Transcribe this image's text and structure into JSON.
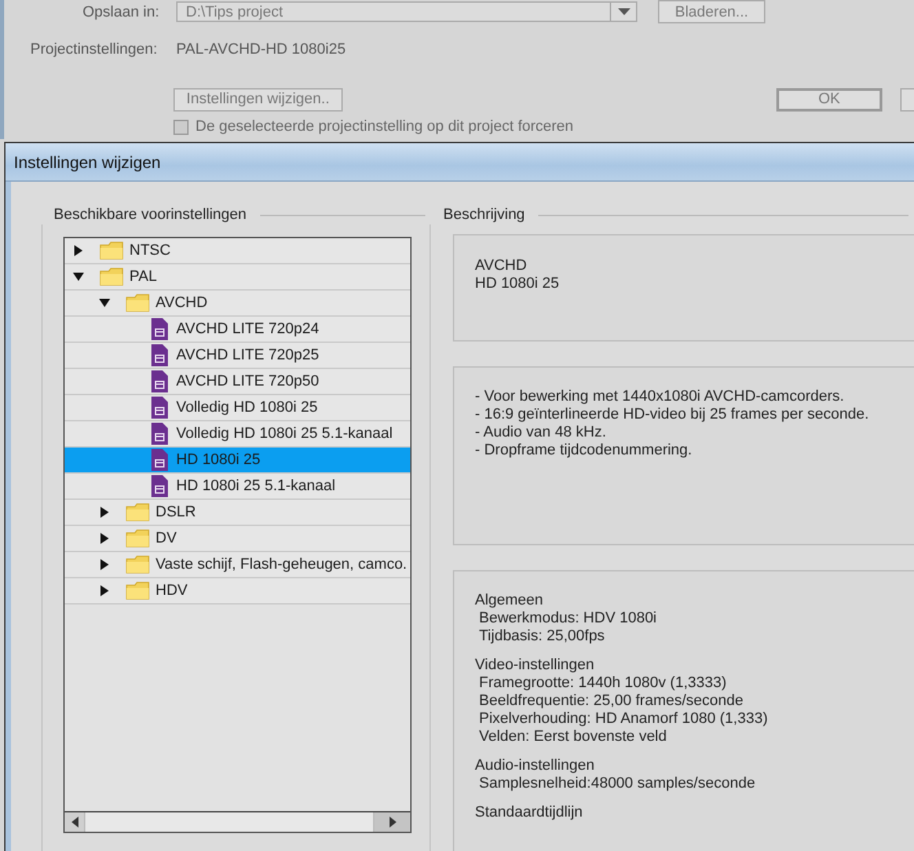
{
  "background_dialog": {
    "save_label": "Opslaan in:",
    "save_path": "D:\\Tips project",
    "browse_button": "Bladeren...",
    "project_settings_label": "Projectinstellingen:",
    "project_settings_value": "PAL-AVCHD-HD 1080i25",
    "change_button": "Instellingen wijzigen..",
    "ok_button": "OK",
    "force_checkbox": {
      "label": "De geselecteerde projectinstelling op dit project forceren",
      "checked": false
    }
  },
  "dialog": {
    "title": "Instellingen wijzigen",
    "presets": {
      "title": "Beschikbare voorinstellingen",
      "items": [
        {
          "kind": "folder",
          "label": "NTSC",
          "expanded": false,
          "selected": false
        },
        {
          "kind": "folder",
          "label": "PAL",
          "expanded": true,
          "selected": false,
          "children": [
            {
              "kind": "folder",
              "label": "AVCHD",
              "expanded": true,
              "selected": false,
              "children": [
                {
                  "kind": "preset",
                  "label": "AVCHD LITE 720p24",
                  "selected": false
                },
                {
                  "kind": "preset",
                  "label": "AVCHD LITE 720p25",
                  "selected": false
                },
                {
                  "kind": "preset",
                  "label": "AVCHD LITE 720p50",
                  "selected": false
                },
                {
                  "kind": "preset",
                  "label": "Volledig HD 1080i 25",
                  "selected": false
                },
                {
                  "kind": "preset",
                  "label": "Volledig HD 1080i 25 5.1-kanaal",
                  "selected": false
                },
                {
                  "kind": "preset",
                  "label": "HD 1080i 25",
                  "selected": true
                },
                {
                  "kind": "preset",
                  "label": "HD 1080i 25 5.1-kanaal",
                  "selected": false
                }
              ]
            },
            {
              "kind": "folder",
              "label": "DSLR",
              "expanded": false,
              "selected": false
            },
            {
              "kind": "folder",
              "label": "DV",
              "expanded": false,
              "selected": false
            },
            {
              "kind": "folder",
              "label": "Vaste schijf, Flash-geheugen, camco.",
              "expanded": false,
              "selected": false
            },
            {
              "kind": "folder",
              "label": "HDV",
              "expanded": false,
              "selected": false
            }
          ]
        }
      ]
    },
    "description": {
      "title": "Beschrijving",
      "summary": [
        "AVCHD",
        "HD 1080i 25"
      ],
      "notes": [
        "- Voor bewerking met 1440x1080i AVCHD-camcorders.",
        "- 16:9 geïnterlineerde HD-video bij 25 frames per seconde.",
        "- Audio van 48 kHz.",
        "- Dropframe tijdcodenummering."
      ],
      "details": [
        {
          "heading": "Algemeen",
          "lines": [
            "Bewerkmodus: HDV 1080i",
            "Tijdbasis: 25,00fps"
          ]
        },
        {
          "heading": "Video-instellingen",
          "lines": [
            "Framegrootte: 1440h 1080v (1,3333)",
            "Beeldfrequentie: 25,00 frames/seconde",
            "Pixelverhouding: HD Anamorf 1080 (1,333)",
            "Velden: Eerst bovenste veld"
          ]
        },
        {
          "heading": "Audio-instellingen",
          "lines": [
            "Samplesnelheid:48000 samples/seconde"
          ]
        },
        {
          "heading": "Standaardtijdlijn"
        }
      ]
    }
  }
}
